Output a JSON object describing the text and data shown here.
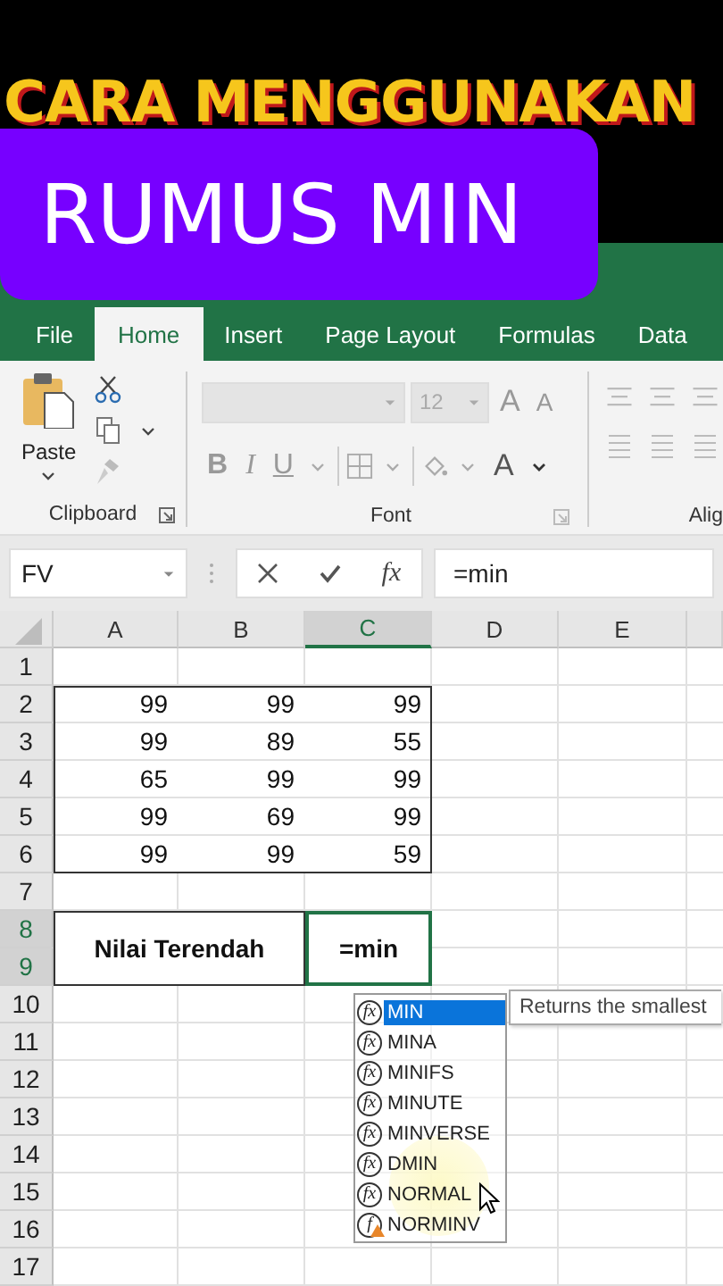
{
  "headline": {
    "line1": "CARA MENGGUNAKAN",
    "line2": "RUMUS MIN"
  },
  "tabs": [
    {
      "label": "File",
      "selected": false
    },
    {
      "label": "Home",
      "selected": true
    },
    {
      "label": "Insert",
      "selected": false
    },
    {
      "label": "Page Layout",
      "selected": false
    },
    {
      "label": "Formulas",
      "selected": false
    },
    {
      "label": "Data",
      "selected": false
    }
  ],
  "ribbon": {
    "clipboard": {
      "paste_label": "Paste",
      "group_label": "Clipboard"
    },
    "font": {
      "size": "12",
      "grow": "A",
      "shrink": "A",
      "bold": "B",
      "italic": "I",
      "underline": "U",
      "font_color": "A",
      "group_label": "Font"
    },
    "alignment": {
      "group_label": "Alig"
    }
  },
  "formula_bar": {
    "name_box": "FV",
    "function_label": "fx",
    "formula": "=min"
  },
  "sheet": {
    "columns": [
      {
        "label": "A",
        "selected": false
      },
      {
        "label": "B",
        "selected": false
      },
      {
        "label": "C",
        "selected": true
      },
      {
        "label": "D",
        "selected": false
      },
      {
        "label": "E",
        "selected": false
      }
    ],
    "rows": [
      {
        "label": "1",
        "selected": false
      },
      {
        "label": "2",
        "selected": false,
        "cells": [
          "99",
          "99",
          "99"
        ]
      },
      {
        "label": "3",
        "selected": false,
        "cells": [
          "99",
          "89",
          "55"
        ]
      },
      {
        "label": "4",
        "selected": false,
        "cells": [
          "65",
          "99",
          "99"
        ]
      },
      {
        "label": "5",
        "selected": false,
        "cells": [
          "99",
          "69",
          "99"
        ]
      },
      {
        "label": "6",
        "selected": false,
        "cells": [
          "99",
          "99",
          "59"
        ]
      },
      {
        "label": "7",
        "selected": false
      },
      {
        "label": "8",
        "selected": true
      },
      {
        "label": "9",
        "selected": true
      },
      {
        "label": "10",
        "selected": false
      },
      {
        "label": "11",
        "selected": false
      },
      {
        "label": "12",
        "selected": false
      },
      {
        "label": "13",
        "selected": false
      },
      {
        "label": "14",
        "selected": false
      },
      {
        "label": "15",
        "selected": false
      },
      {
        "label": "16",
        "selected": false
      },
      {
        "label": "17",
        "selected": false
      }
    ],
    "label_cell": "Nilai Terendah",
    "active_cell": "=min"
  },
  "autocomplete": {
    "items": [
      {
        "icon": "fx",
        "name": "MIN",
        "selected": true,
        "kind": "function"
      },
      {
        "icon": "fx",
        "name": "MINA",
        "selected": false,
        "kind": "function"
      },
      {
        "icon": "fx",
        "name": "MINIFS",
        "selected": false,
        "kind": "function"
      },
      {
        "icon": "fx",
        "name": "MINUTE",
        "selected": false,
        "kind": "function"
      },
      {
        "icon": "fx",
        "name": "MINVERSE",
        "selected": false,
        "kind": "function"
      },
      {
        "icon": "fx",
        "name": "DMIN",
        "selected": false,
        "kind": "function"
      },
      {
        "icon": "fx",
        "name": "NORMAL",
        "selected": false,
        "kind": "function"
      },
      {
        "icon": "f",
        "name": "NORMINV",
        "selected": false,
        "kind": "compatibility"
      }
    ],
    "tooltip": "Returns the smallest"
  }
}
